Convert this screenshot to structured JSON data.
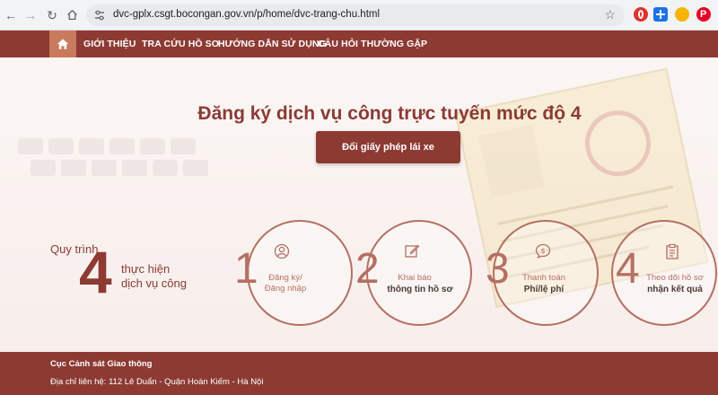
{
  "browser": {
    "url": "dvc-gplx.csgt.bocongan.gov.vn/p/home/dvc-trang-chu.html"
  },
  "nav": {
    "items": [
      "GIỚI THIỆU",
      "TRA CỨU HỒ SƠ",
      "HƯỚNG DẪN SỬ DỤNG",
      "CÂU HỎI THƯỜNG GẶP"
    ]
  },
  "hero": {
    "title": "Đăng ký dịch vụ công trực tuyến mức độ 4",
    "cta_label": "Đổi giấy phép lái xe"
  },
  "process": {
    "label": "Quy trình",
    "count": "4",
    "line1": "thực hiện",
    "line2": "dịch vụ công",
    "steps": [
      {
        "num": "1",
        "line1": "Đăng ký/",
        "line2": "Đăng nhập",
        "icon": "user-icon"
      },
      {
        "num": "2",
        "line1": "Khai báo",
        "line2": "thông tin hồ sơ",
        "icon": "edit-icon"
      },
      {
        "num": "3",
        "line1": "Thanh toán",
        "line2": "Phí/lệ phí",
        "icon": "payment-icon"
      },
      {
        "num": "4",
        "line1": "Theo dõi hồ sơ",
        "line2": "nhận kết quả",
        "icon": "clipboard-icon"
      }
    ]
  },
  "footer": {
    "org": "Cục Cảnh sát Giao thông",
    "address": "Địa chỉ liên hệ: 112 Lê Duẩn - Quận Hoàn Kiếm - Hà Nội"
  },
  "colors": {
    "brand": "#8d3a33",
    "accent": "#b56f63",
    "home_active": "#c97a5c"
  }
}
